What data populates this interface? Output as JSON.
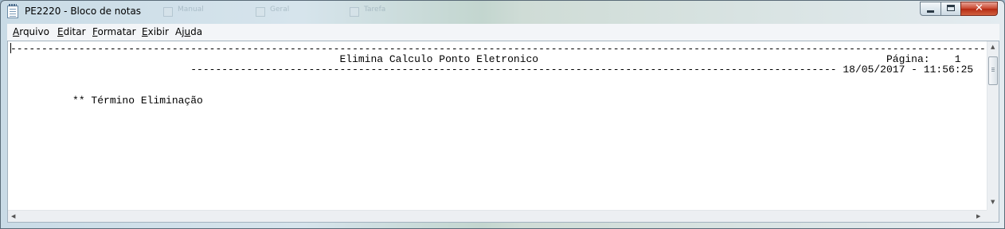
{
  "window": {
    "title": "PE2220 - Bloco de notas",
    "background_tabs": [
      "Manual",
      "Geral",
      "Tarefa"
    ],
    "close_glyph": "✕"
  },
  "menu": {
    "items": [
      {
        "pre": "",
        "key": "A",
        "post": "rquivo"
      },
      {
        "pre": "",
        "key": "E",
        "post": "ditar"
      },
      {
        "pre": "",
        "key": "F",
        "post": "ormatar"
      },
      {
        "pre": "",
        "key": "E",
        "post": "xibir"
      },
      {
        "pre": "Aj",
        "key": "u",
        "post": "da"
      }
    ]
  },
  "document": {
    "lines": [
      "------------------------------------------------------------------------------------------------------------------------------------------------------------------",
      "                                                     Elimina Calculo Ponto Eletronico                                                        Página:    1",
      "                             -------------------------------------------------------------------------------------------------------- 18/05/2017 - 11:56:25",
      "",
      "",
      "          ** Término Eliminação"
    ]
  },
  "scrollbars": {
    "up_arrow": "▲",
    "down_arrow": "▼",
    "left_arrow": "◀",
    "right_arrow": "▶"
  },
  "icons": {
    "app": "notepad-icon",
    "minimize": "minimize-icon",
    "maximize": "maximize-icon",
    "close": "close-icon"
  },
  "colors": {
    "close_button": "#c7442c",
    "menu_bg": "#f3f5f8",
    "editor_bg": "#ffffff"
  }
}
